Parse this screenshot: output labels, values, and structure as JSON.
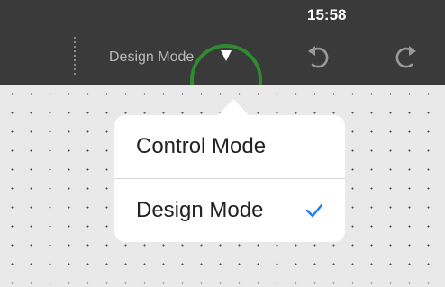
{
  "status_bar": {
    "time": "15:58"
  },
  "toolbar": {
    "mode_label": "Design Mode",
    "icons": {
      "dropdown": "dropdown-arrow-icon",
      "undo": "undo-icon",
      "redo": "redo-icon"
    }
  },
  "popover": {
    "items": [
      {
        "label": "Control Mode",
        "selected": false
      },
      {
        "label": "Design Mode",
        "selected": true
      }
    ],
    "check_color": "#1e7cf2"
  },
  "colors": {
    "toolbar_bg": "#3a3a3a",
    "highlight": "#2e8b2e",
    "canvas_bg": "#e9e9e9"
  }
}
